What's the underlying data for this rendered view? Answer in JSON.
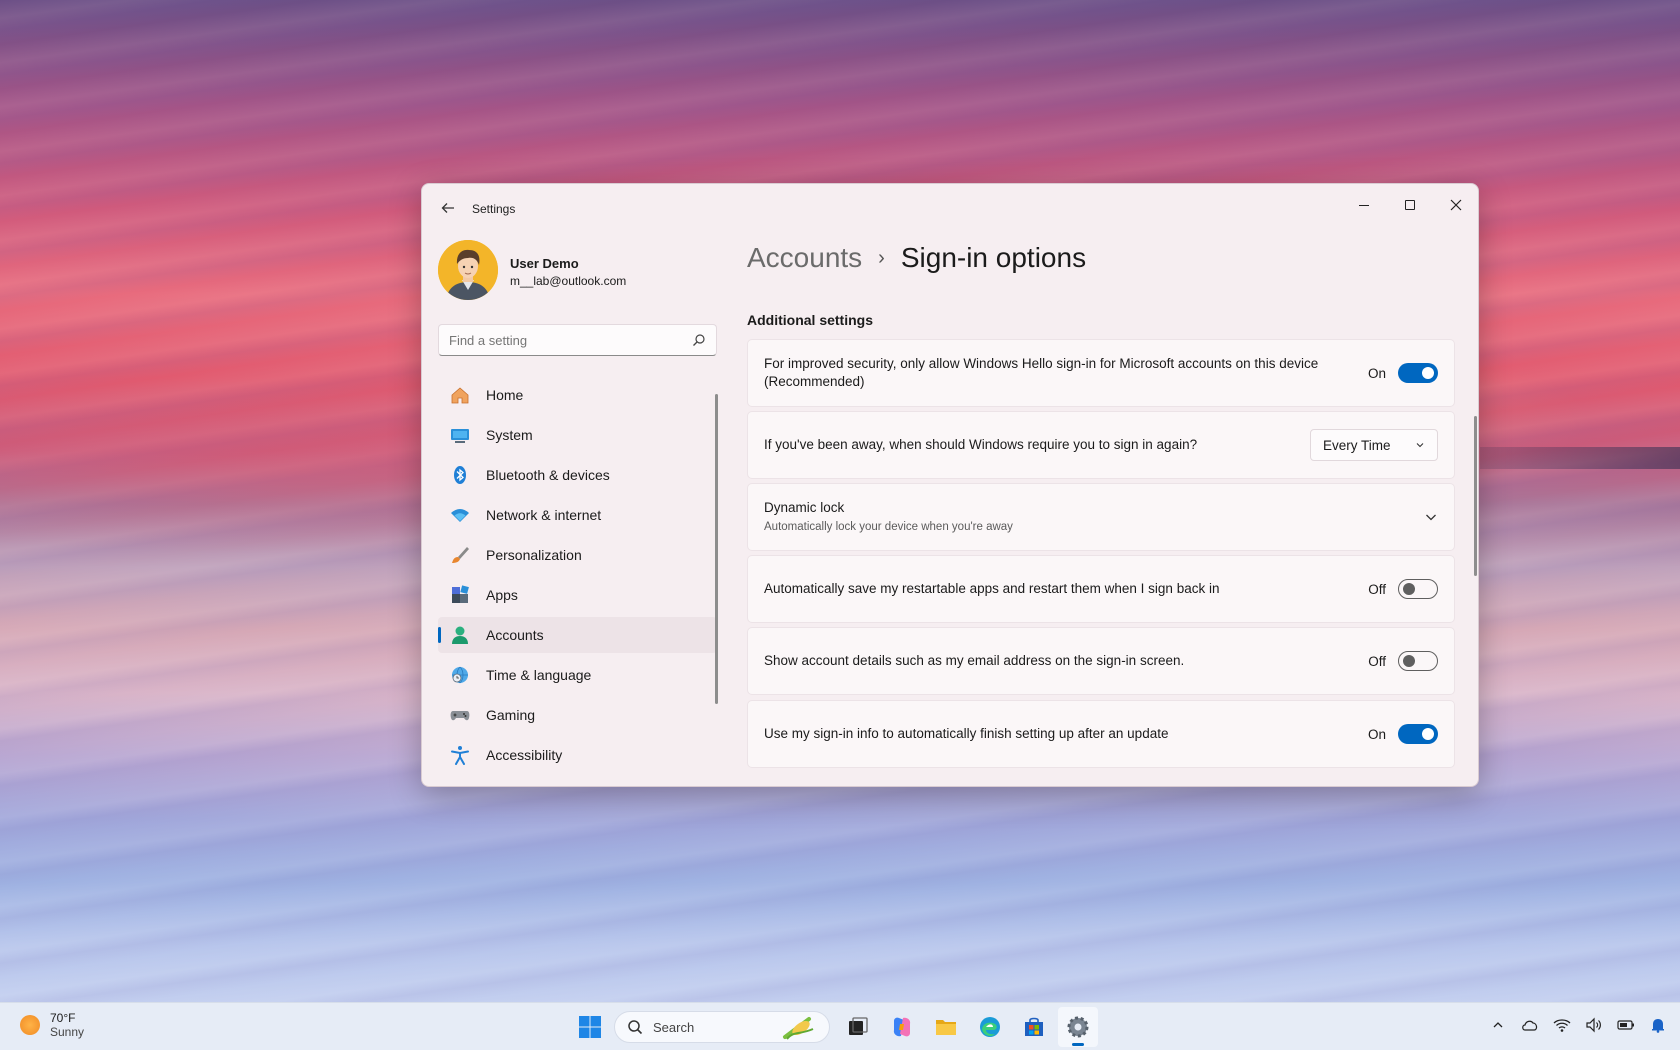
{
  "window": {
    "title": "Settings"
  },
  "profile": {
    "name": "User Demo",
    "email": "m__lab@outlook.com"
  },
  "search": {
    "placeholder": "Find a setting"
  },
  "nav": {
    "items": [
      {
        "label": "Home",
        "icon": "home-icon"
      },
      {
        "label": "System",
        "icon": "system-icon"
      },
      {
        "label": "Bluetooth & devices",
        "icon": "bluetooth-icon"
      },
      {
        "label": "Network & internet",
        "icon": "wifi-icon"
      },
      {
        "label": "Personalization",
        "icon": "brush-icon"
      },
      {
        "label": "Apps",
        "icon": "apps-icon"
      },
      {
        "label": "Accounts",
        "icon": "accounts-icon",
        "active": true
      },
      {
        "label": "Time & language",
        "icon": "globe-clock-icon"
      },
      {
        "label": "Gaming",
        "icon": "gamepad-icon"
      },
      {
        "label": "Accessibility",
        "icon": "accessibility-icon"
      }
    ]
  },
  "header": {
    "parent": "Accounts",
    "separator": "›",
    "current": "Sign-in options"
  },
  "section": {
    "title": "Additional settings"
  },
  "settings": [
    {
      "line1": "For improved security, only allow Windows Hello sign-in for Microsoft accounts on this device",
      "line2": "(Recommended)",
      "state_label": "On",
      "state": true
    },
    {
      "text": "If you've been away, when should Windows require you to sign in again?",
      "selected": "Every Time"
    },
    {
      "title": "Dynamic lock",
      "subtitle": "Automatically lock your device when you're away"
    },
    {
      "text": "Automatically save my restartable apps and restart them when I sign back in",
      "state_label": "Off",
      "state": false
    },
    {
      "text": "Show account details such as my email address on the sign-in screen.",
      "state_label": "Off",
      "state": false
    },
    {
      "text": "Use my sign-in info to automatically finish setting up after an update",
      "state_label": "On",
      "state": true
    }
  ],
  "taskbar": {
    "weather_temp": "70°F",
    "weather_condition": "Sunny",
    "search_label": "Search"
  },
  "colors": {
    "accent": "#0067c0",
    "window_bg": "#f6eef1"
  }
}
